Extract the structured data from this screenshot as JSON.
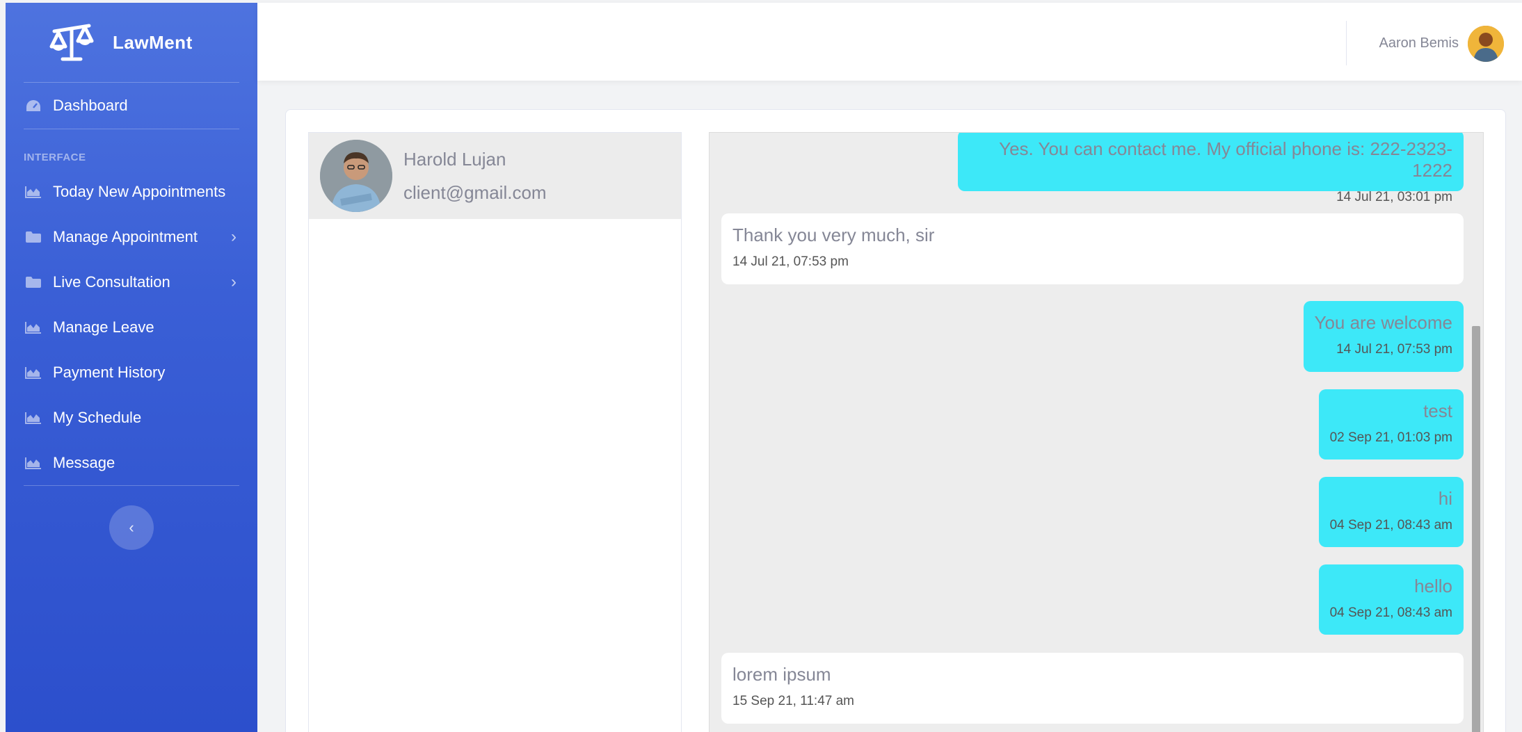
{
  "brand": {
    "name": "LawMent",
    "logo_icon": "scales-of-justice-icon"
  },
  "sidebar": {
    "dashboard": {
      "label": "Dashboard",
      "icon": "speedometer-icon"
    },
    "section_heading": "INTERFACE",
    "items": [
      {
        "label": "Today New Appointments",
        "icon": "area-chart-icon",
        "has_submenu": false
      },
      {
        "label": "Manage Appointment",
        "icon": "folder-icon",
        "has_submenu": true
      },
      {
        "label": "Live Consultation",
        "icon": "folder-icon",
        "has_submenu": true
      },
      {
        "label": "Manage Leave",
        "icon": "area-chart-icon",
        "has_submenu": false
      },
      {
        "label": "Payment History",
        "icon": "area-chart-icon",
        "has_submenu": false
      },
      {
        "label": "My Schedule",
        "icon": "area-chart-icon",
        "has_submenu": false
      },
      {
        "label": "Message",
        "icon": "area-chart-icon",
        "has_submenu": false
      }
    ],
    "collapse_icon": "chevron-left-icon"
  },
  "topbar": {
    "user_name": "Aaron Bemis"
  },
  "contacts": [
    {
      "name": "Harold Lujan",
      "email": "client@gmail.com"
    }
  ],
  "messages": [
    {
      "type": "sent",
      "text": "Yes. You can contact me. My official phone is: 222-2323-1222",
      "time": "14 Jul 21, 03:01 pm"
    },
    {
      "type": "recv",
      "text": "Thank you very much, sir",
      "time": "14 Jul 21, 07:53 pm"
    },
    {
      "type": "sent",
      "text": "You are welcome",
      "time": "14 Jul 21, 07:53 pm"
    },
    {
      "type": "sent",
      "text": "test",
      "time": "02 Sep 21, 01:03 pm"
    },
    {
      "type": "sent",
      "text": "hi",
      "time": "04 Sep 21, 08:43 am"
    },
    {
      "type": "sent",
      "text": "hello",
      "time": "04 Sep 21, 08:43 am"
    },
    {
      "type": "recv",
      "text": "lorem ipsum",
      "time": "15 Sep 21, 11:47 am"
    }
  ],
  "colors": {
    "sidebar_top": "#4e73df",
    "sidebar_bottom": "#2c4fcc",
    "sent_bubble": "#3de8f8",
    "chat_bg": "#ededed"
  }
}
